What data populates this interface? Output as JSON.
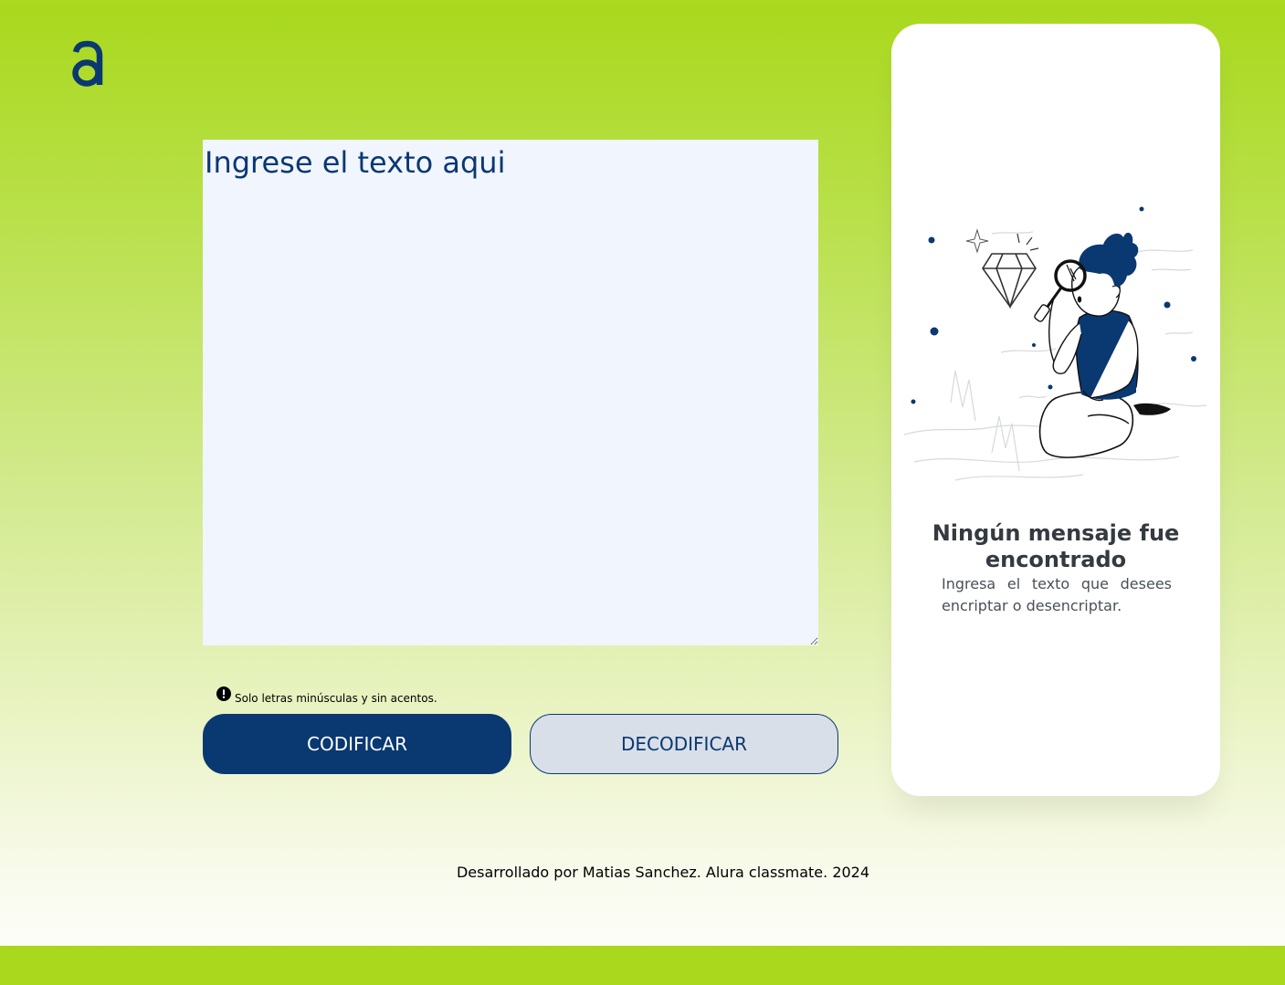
{
  "colors": {
    "accent": "#0a3871",
    "brand_green": "#a9d81d",
    "input_background": "#f1f5fe",
    "secondary_button": "#d8dfe8"
  },
  "header": {
    "logo_icon": "alura-logo-icon"
  },
  "input": {
    "placeholder": "Ingrese el texto aqui",
    "value": ""
  },
  "hint": {
    "icon": "exclamation-circle-icon",
    "text": "Solo letras minúsculas y sin acentos."
  },
  "buttons": {
    "encode_label": "CODIFICAR",
    "decode_label": "DECODIFICAR"
  },
  "result": {
    "illustration": "boy-with-magnifying-glass-illustration",
    "title": "Ningún mensaje fue encontrado",
    "description": "Ingresa el texto que desees encriptar o desencriptar."
  },
  "footer": {
    "credit": "Desarrollado por Matias Sanchez. Alura classmate. 2024"
  }
}
